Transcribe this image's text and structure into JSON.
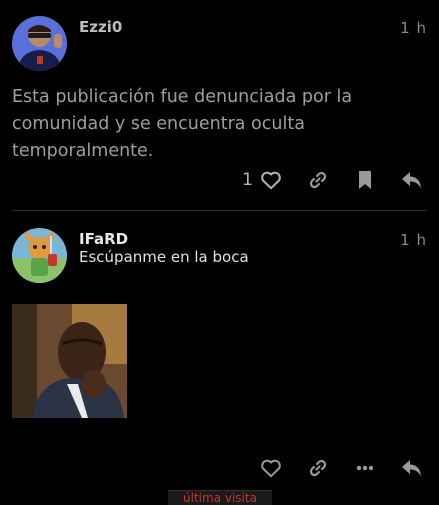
{
  "posts": [
    {
      "username": "Ezzi0",
      "time": "1 h",
      "body": "Esta publicación fue denunciada por la comunidad y se encuentra oculta temporalmente.",
      "likes": "1",
      "actions": [
        "heart-icon",
        "link-icon",
        "bookmark-icon",
        "reply-icon"
      ]
    },
    {
      "username": "IFaRD",
      "time": "1 h",
      "body": "Escúpanme en la boca",
      "actions": [
        "heart-icon",
        "link-icon",
        "more-icon",
        "reply-icon"
      ]
    }
  ],
  "last_visit": "última visita",
  "colors": {
    "background": "#000000",
    "text_muted": "#9e9e9e",
    "icon": "#9a9a9a",
    "last_visit": "#c0392b"
  }
}
